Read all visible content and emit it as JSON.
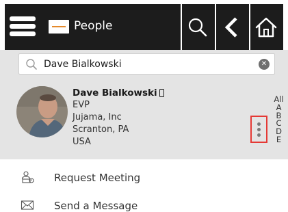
{
  "header": {
    "title": "People",
    "menu_icon": "hamburger-menu-icon",
    "logo": "app-logo",
    "search_icon": "search-icon",
    "back_icon": "back-arrow-icon",
    "home_icon": "home-icon",
    "background": "#1c1c1c"
  },
  "search": {
    "value": "Dave Bialkowski",
    "clear_icon": "clear-search-icon"
  },
  "contact": {
    "name": "Dave Bialkowski",
    "title": "EVP",
    "company": "Jujama, Inc",
    "location": "Scranton, PA",
    "country": "USA",
    "phone_icon": "mobile-phone-icon",
    "more_icon": "more-options-icon"
  },
  "alpha_index": [
    "All",
    "A",
    "B",
    "C",
    "D",
    "E"
  ],
  "actions": [
    {
      "label": "Request Meeting",
      "icon": "request-meeting-icon"
    },
    {
      "label": "Send a Message",
      "icon": "envelope-icon"
    }
  ],
  "colors": {
    "highlight_border": "#e53935",
    "card_background": "#e4e4e4"
  }
}
